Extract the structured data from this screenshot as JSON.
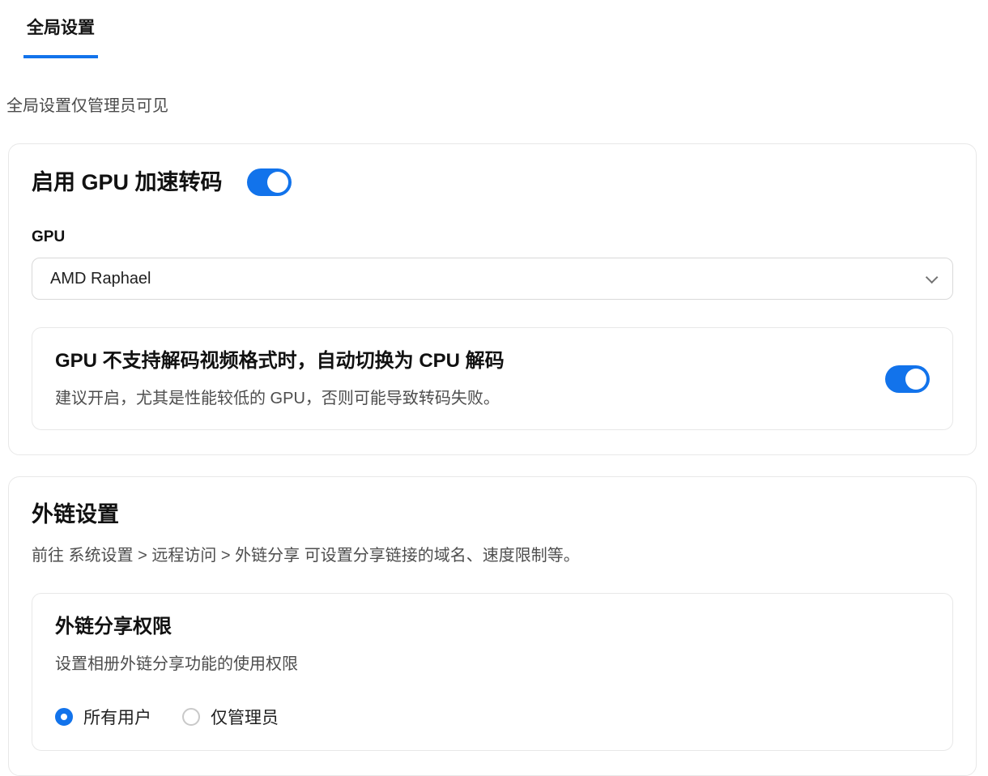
{
  "colors": {
    "accent": "#1273eb",
    "card_border": "#e8e8e8",
    "secondary_text": "#4d4d4d"
  },
  "tab": {
    "label": "全局设置"
  },
  "subtitle": "全局设置仅管理员可见",
  "gpu_section": {
    "title": "启用 GPU 加速转码",
    "toggle_on": true,
    "gpu_field": {
      "label": "GPU",
      "selected_value": "AMD Raphael"
    },
    "fallback_card": {
      "title": "GPU 不支持解码视频格式时，自动切换为 CPU 解码",
      "description": "建议开启，尤其是性能较低的 GPU，否则可能导致转码失败。",
      "toggle_on": true
    }
  },
  "external_link_section": {
    "title": "外链设置",
    "description": "前往 系统设置 > 远程访问 > 外链分享 可设置分享链接的域名、速度限制等。",
    "permission_card": {
      "title": "外链分享权限",
      "description": "设置相册外链分享功能的使用权限",
      "options": [
        {
          "label": "所有用户",
          "selected": true
        },
        {
          "label": "仅管理员",
          "selected": false
        }
      ]
    }
  }
}
